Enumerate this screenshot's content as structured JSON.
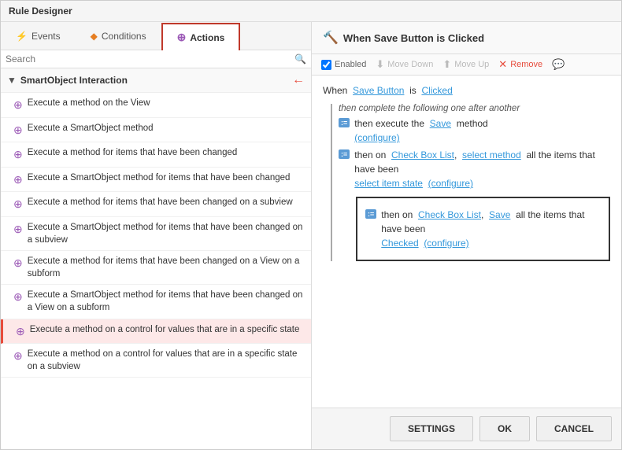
{
  "title": "Rule Designer",
  "tabs": [
    {
      "id": "events",
      "label": "Events",
      "icon": "⚡",
      "active": false
    },
    {
      "id": "conditions",
      "label": "Conditions",
      "icon": "◆",
      "active": false
    },
    {
      "id": "actions",
      "label": "Actions",
      "icon": "⊕",
      "active": true
    }
  ],
  "search": {
    "placeholder": "Search"
  },
  "section": {
    "label": "SmartObject Interaction"
  },
  "list_items": [
    {
      "id": 1,
      "text": "Execute a method on the View"
    },
    {
      "id": 2,
      "text": "Execute a SmartObject method"
    },
    {
      "id": 3,
      "text": "Execute a method for items that have been changed"
    },
    {
      "id": 4,
      "text": "Execute a SmartObject method for items that have been changed"
    },
    {
      "id": 5,
      "text": "Execute a method for items that have been changed on a subview"
    },
    {
      "id": 6,
      "text": "Execute a SmartObject method for items that have been changed on a subview"
    },
    {
      "id": 7,
      "text": "Execute a method for items that have been changed on a View on a subform"
    },
    {
      "id": 8,
      "text": "Execute a SmartObject method for items that have been changed on a View on a subform"
    },
    {
      "id": 9,
      "text": "Execute a method on a control for values that are in a specific state",
      "highlighted": true
    },
    {
      "id": 10,
      "text": "Execute a method on a control for values that are in a specific state on a subview"
    }
  ],
  "right_header": {
    "icon": "🔨",
    "title": "When Save Button is Clicked"
  },
  "toolbar": {
    "enabled_label": "Enabled",
    "move_down_label": "Move Down",
    "move_up_label": "Move Up",
    "remove_label": "Remove"
  },
  "trigger": {
    "when": "When",
    "button": "Save Button",
    "is": "is",
    "event": "Clicked"
  },
  "flow_label": "then complete the following one after another",
  "actions": [
    {
      "id": 1,
      "prefix": "then execute the",
      "method_link": "Save",
      "suffix": "method",
      "configure": "(configure)"
    },
    {
      "id": 2,
      "prefix": "then on",
      "control_link": "Check Box List",
      "comma": ",",
      "method_link": "select method",
      "middle": "all the items that have been",
      "state_link": "select item state",
      "configure": "(configure)",
      "highlighted": false
    },
    {
      "id": 3,
      "prefix": "then on",
      "control_link": "Check Box List",
      "comma": ",",
      "method_link": "Save",
      "middle": "all the items that have been",
      "state_link": "Checked",
      "configure": "(configure)",
      "highlighted": true
    }
  ],
  "buttons": {
    "settings": "SETTINGS",
    "ok": "OK",
    "cancel": "CANCEL"
  }
}
